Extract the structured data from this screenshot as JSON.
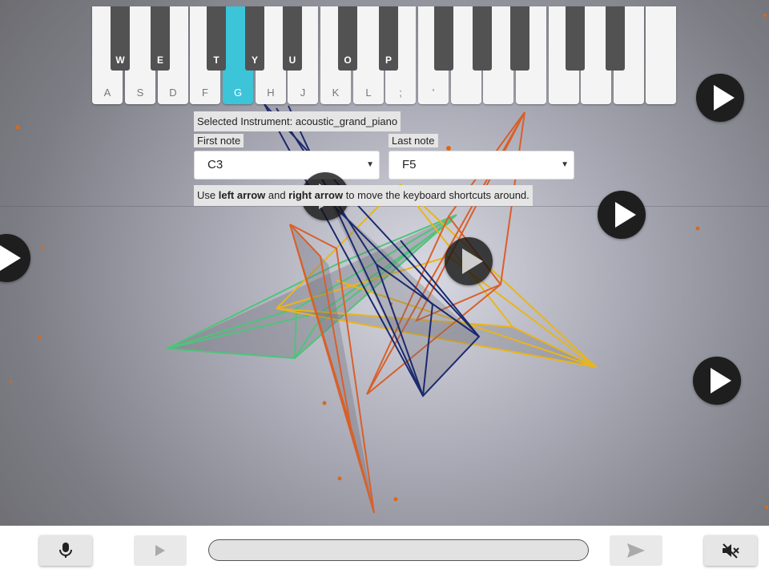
{
  "keyboard": {
    "white_keys": [
      {
        "label": "A",
        "active": false
      },
      {
        "label": "S",
        "active": false
      },
      {
        "label": "D",
        "active": false
      },
      {
        "label": "F",
        "active": false
      },
      {
        "label": "G",
        "active": true
      },
      {
        "label": "H",
        "active": false
      },
      {
        "label": "J",
        "active": false
      },
      {
        "label": "K",
        "active": false
      },
      {
        "label": "L",
        "active": false
      },
      {
        "label": ";",
        "active": false
      },
      {
        "label": "'",
        "active": false
      },
      {
        "label": "",
        "active": false
      },
      {
        "label": "",
        "active": false
      },
      {
        "label": "",
        "active": false
      },
      {
        "label": "",
        "active": false
      },
      {
        "label": "",
        "active": false
      },
      {
        "label": "",
        "active": false
      },
      {
        "label": "",
        "active": false
      }
    ],
    "black_keys": [
      "W",
      "E",
      "T",
      "Y",
      "U",
      "O",
      "P",
      "",
      "",
      "",
      "",
      ""
    ],
    "active_color": "#3cc4d9"
  },
  "instrument": {
    "selected_text": "Selected Instrument: acoustic_grand_piano"
  },
  "range": {
    "first_note_label": "First note",
    "first_note_value": "C3",
    "last_note_label": "Last note",
    "last_note_value": "F5"
  },
  "hint": {
    "prefix": "Use ",
    "left": "left arrow",
    "middle": " and ",
    "right": "right arrow",
    "suffix": " to move the keyboard shortcuts around."
  },
  "toolbar": {
    "mic_icon": "microphone-icon",
    "play_icon": "play-icon",
    "send_icon": "send-icon",
    "mute_icon": "volume-mute-icon",
    "text_value": ""
  },
  "colors": {
    "navy": "#1a2a6e",
    "orange": "#d8602a",
    "yellow": "#e8b51c",
    "green": "#4ec47a",
    "particle": "#d86a1a"
  }
}
